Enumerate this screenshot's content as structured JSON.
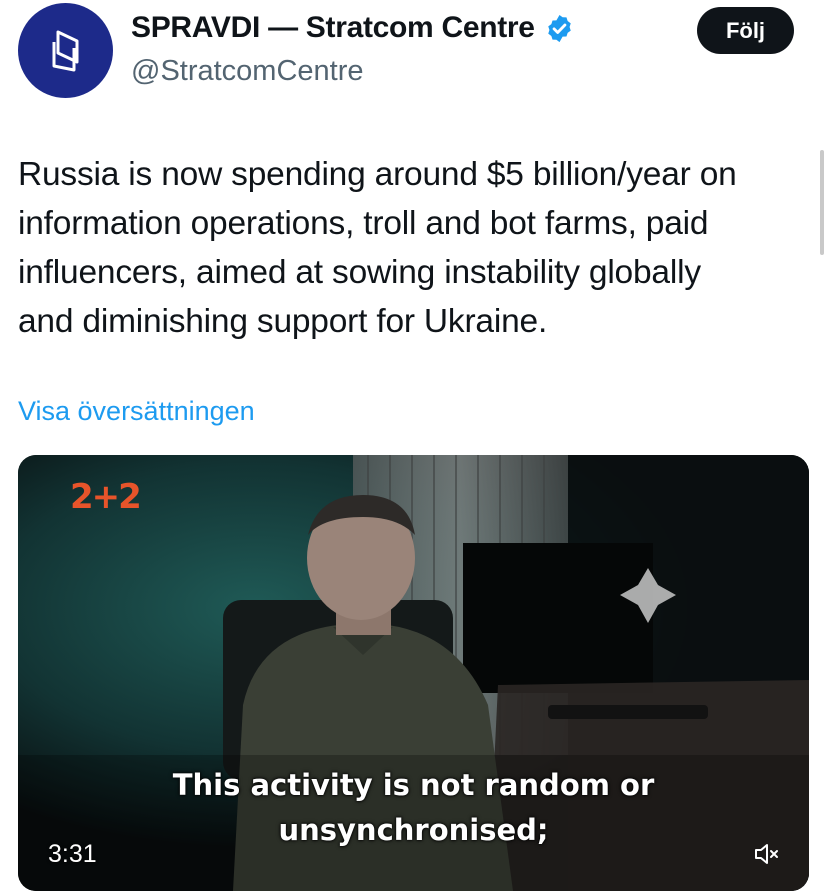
{
  "author": {
    "display_name": "SPRAVDI — Stratcom Centre",
    "handle": "@StratcomCentre",
    "avatar_icon": "spravdi-logo-icon",
    "avatar_color": "#1d2a8a",
    "verified_icon": "verified-badge-icon",
    "verified_color": "#1d9bf0"
  },
  "follow_button": {
    "label": "Följ"
  },
  "tweet": {
    "text_lines": [
      "Russia is now spending around $5 billion/year on",
      "information operations, troll and bot farms, paid",
      "influencers, aimed at sowing instability globally",
      "and diminishing support for Ukraine."
    ],
    "translate_label": "Visa översättningen"
  },
  "video": {
    "channel_logo": "2+2",
    "channel_logo_color": "#e8542a",
    "subtitle_lines": [
      "This activity is not random or",
      "unsynchronised;"
    ],
    "duration": "3:31",
    "mute_icon": "speaker-muted-icon"
  },
  "colors": {
    "link": "#1d9bf0",
    "text_primary": "#0f1419",
    "text_secondary": "#536471",
    "button_bg": "#0f1419"
  }
}
